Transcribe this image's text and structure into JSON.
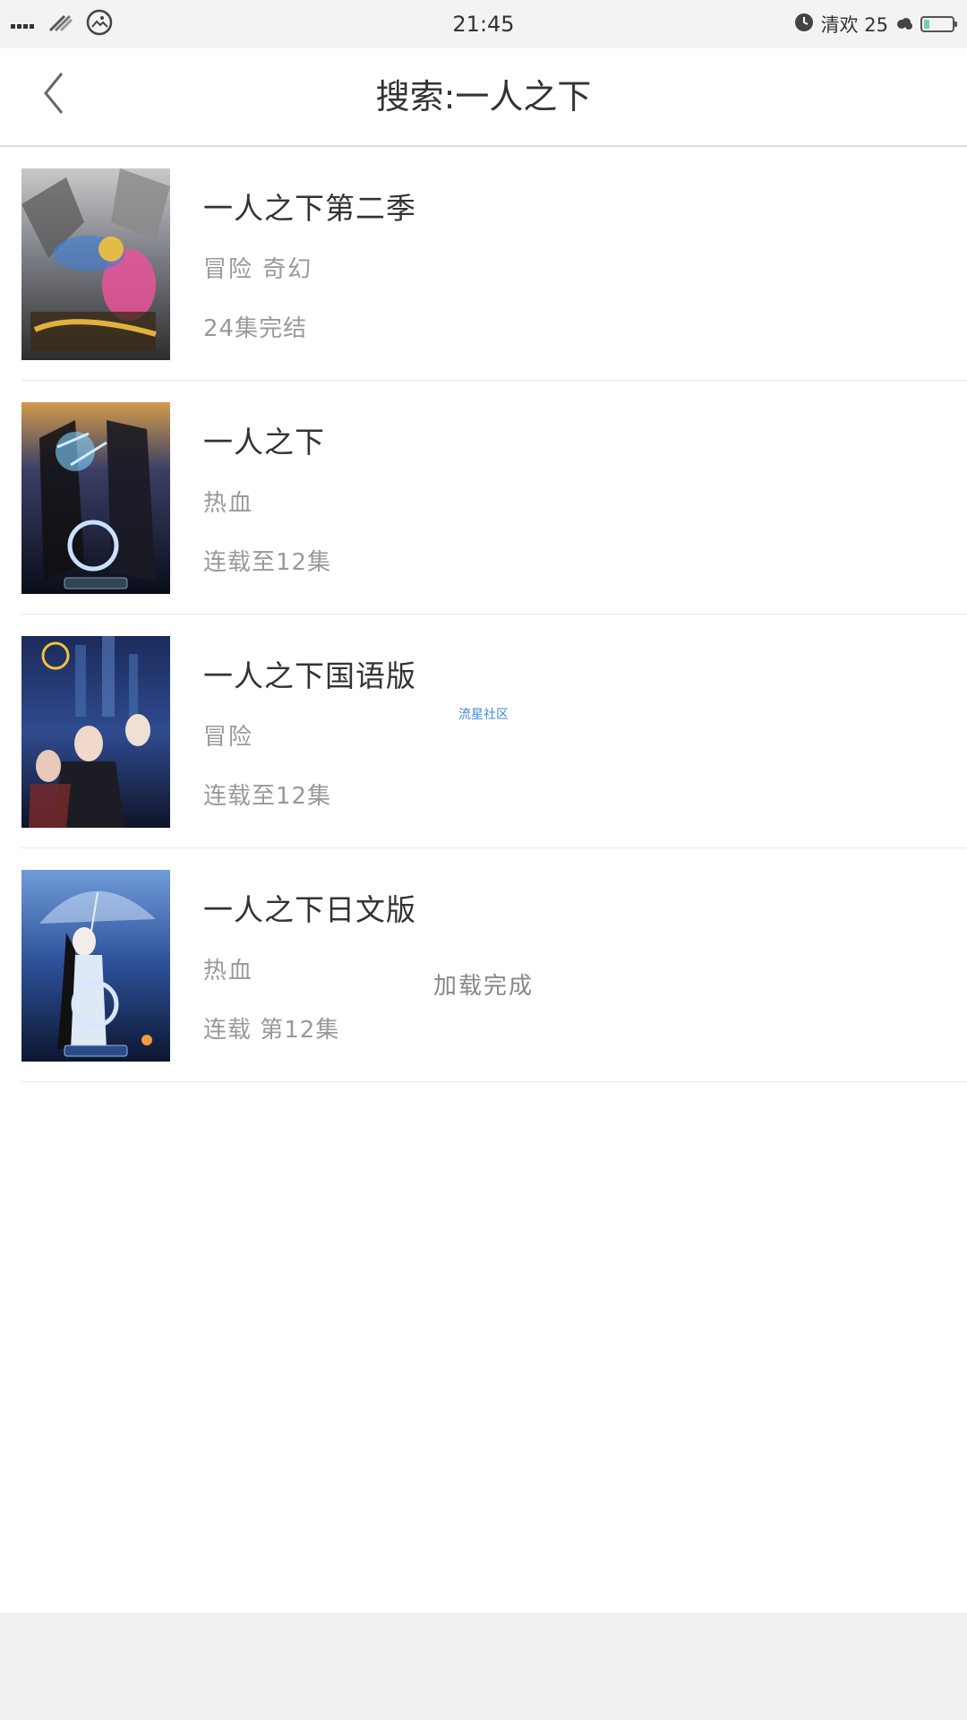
{
  "status_bar": {
    "time": "21:45",
    "weather": "清欢 25",
    "battery_level": 0.2
  },
  "header": {
    "title": "搜索:一人之下",
    "back_icon": "chevron-left-icon"
  },
  "results": [
    {
      "title": "一人之下第二季",
      "genre": "冒险 奇幻",
      "status": "24集完结"
    },
    {
      "title": "一人之下",
      "genre": "热血",
      "status": "连载至12集"
    },
    {
      "title": "一人之下国语版",
      "genre": "冒险",
      "status": "连载至12集"
    },
    {
      "title": "一人之下日文版",
      "genre": "热血",
      "status": "连载 第12集"
    }
  ],
  "watermark": "流星社区",
  "footer": {
    "load_status": "加载完成"
  },
  "colors": {
    "title_text": "#333333",
    "secondary_text": "#999999",
    "divider": "#e6e6e6",
    "watermark": "#3a8ad8"
  }
}
